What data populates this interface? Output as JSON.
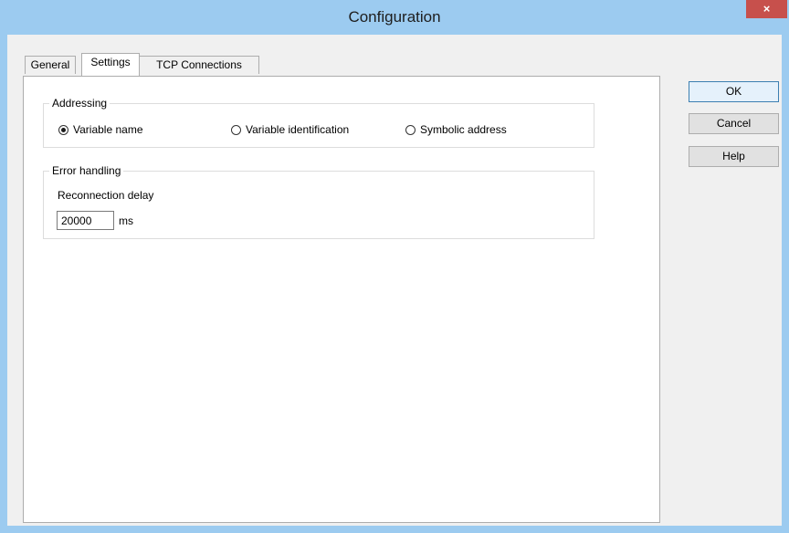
{
  "window": {
    "title": "Configuration",
    "close_glyph": "×"
  },
  "tabs": [
    {
      "label": "General",
      "active": false
    },
    {
      "label": "Settings",
      "active": true
    },
    {
      "label": "TCP Connections",
      "active": false
    }
  ],
  "addressing": {
    "label": "Addressing",
    "options": [
      {
        "label": "Variable name",
        "checked": true
      },
      {
        "label": "Variable identification",
        "checked": false
      },
      {
        "label": "Symbolic address",
        "checked": false
      }
    ]
  },
  "error_handling": {
    "label": "Error handling",
    "reconnection_label": "Reconnection delay",
    "reconnection_value": "20000",
    "unit": "ms"
  },
  "buttons": {
    "ok": "OK",
    "cancel": "Cancel",
    "help": "Help"
  }
}
